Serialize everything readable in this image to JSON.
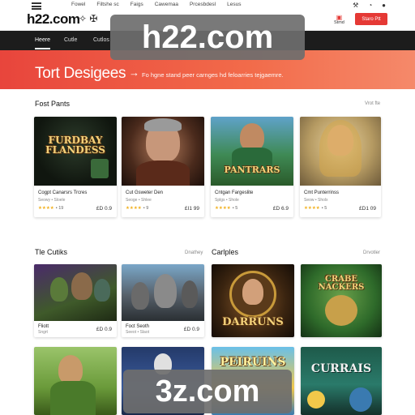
{
  "header": {
    "brand": "h22.com",
    "brand_glyphs": "✧ ✠",
    "top_links": [
      "Fowel",
      "Filtshe sc",
      "Faigs",
      "Cawemaa",
      "Prcesbdesl",
      "Lesus"
    ],
    "top_icons": [
      "⚒",
      "◔",
      "●"
    ],
    "signin_icon": "▣",
    "signin_label": "Stmd",
    "cta_label": "Staro Ptt"
  },
  "nav": {
    "items": [
      "Heere",
      "Cutle",
      "Cutlos"
    ],
    "active_index": 0
  },
  "watermarks": {
    "top": "h22.com",
    "bottom": "3z.com"
  },
  "hero": {
    "title": "Tort Desigees",
    "arrow": "→",
    "subtitle": "Fo hgne stand peer carnges hd feloarries tejgaemre."
  },
  "sections": [
    {
      "title": "Fost Pants",
      "link": "Vrot fte",
      "cards": [
        {
          "art_title": "FURDBAY\nFLANDESS",
          "name": "Cogpt Canarsrs Trcres",
          "meta": "Seowy • Sloele",
          "rating": "★★★★",
          "rating_num": "• 19",
          "price": "£D 0.9"
        },
        {
          "art_title": "",
          "name": "Cut Gsweter Den",
          "meta": "Seoge • Shlee",
          "rating": "★★★★",
          "rating_num": "• 9",
          "price": "£I1 99"
        },
        {
          "art_title": "PANTRARS",
          "name": "Cntgan Fargeslite",
          "meta": "Splgs • Shole",
          "rating": "★★★★",
          "rating_num": "• 5",
          "price": "£D 6.9"
        },
        {
          "art_title": "",
          "name": "Cmt Punterrinss",
          "meta": "Seow • Sholx",
          "rating": "★★★★",
          "rating_num": "• 5",
          "price": "£D1 09"
        }
      ]
    },
    {
      "title": "Tle Cutiks",
      "link": "Dnathey",
      "cards": [
        {
          "art_title": "",
          "name": "Fliott",
          "meta": "Sngrt",
          "rating": "",
          "rating_num": "",
          "price": "£D 0.9"
        },
        {
          "art_title": "",
          "name": "Foct Seoth",
          "meta": "Seeot • Slaot",
          "rating": "",
          "rating_num": "",
          "price": "£D 0.9"
        }
      ]
    },
    {
      "title": "Carlples",
      "link": "Drvotler",
      "cards": [
        {
          "art_title": "DARRUNS",
          "name": "",
          "meta": "",
          "rating": "",
          "rating_num": "",
          "price": ""
        },
        {
          "art_title": "CRABE NACKERS",
          "name": "",
          "meta": "",
          "rating": "",
          "rating_num": "",
          "price": ""
        }
      ]
    },
    {
      "title": "",
      "link": "",
      "cards": [
        {
          "art_title": "",
          "name": "",
          "meta": "",
          "rating": "",
          "rating_num": "",
          "price": ""
        },
        {
          "art_title": "",
          "name": "",
          "meta": "",
          "rating": "",
          "rating_num": "",
          "price": ""
        },
        {
          "art_title": "PEIRUINS",
          "name": "",
          "meta": "",
          "rating": "",
          "rating_num": "",
          "price": ""
        },
        {
          "art_title": "CURRAIS",
          "name": "",
          "meta": "",
          "rating": "",
          "rating_num": "",
          "price": ""
        }
      ]
    }
  ],
  "colors": {
    "accent": "#e53935",
    "hero_start": "#e8453c",
    "hero_end": "#f5896a",
    "nav_bg": "#1c1c1c",
    "star": "#f2b01e"
  }
}
